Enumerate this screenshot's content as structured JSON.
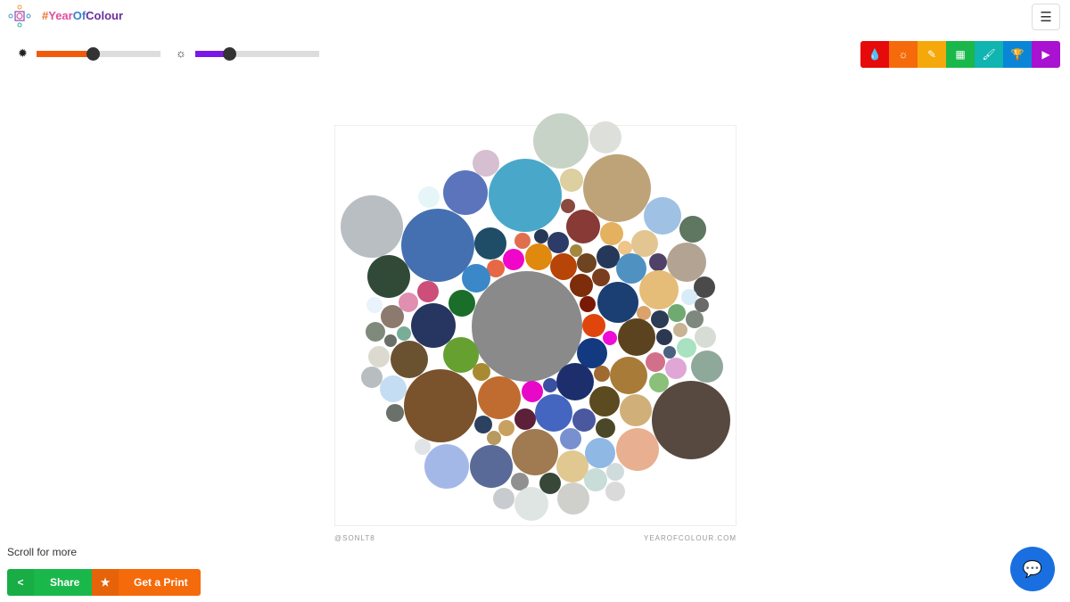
{
  "header": {
    "brand_parts": [
      "#",
      "Year",
      "Of",
      "Colour"
    ],
    "brand_colors": [
      "#e8762b",
      "#e04ea0",
      "#3a7fd0",
      "#6a2ea0"
    ],
    "menu_icon": "hamburger-icon"
  },
  "sliders": [
    {
      "icon": "dark-sun-icon",
      "glyph": "✹",
      "value": 0.45,
      "color": "#f05a0a"
    },
    {
      "icon": "light-sun-icon",
      "glyph": "☼",
      "value": 0.27,
      "color": "#7a18e8"
    }
  ],
  "toolbar": [
    {
      "icon": "drop-icon",
      "glyph": "💧",
      "color": "#e60a0a"
    },
    {
      "icon": "sun-icon",
      "glyph": "☼",
      "color": "#f56a0a"
    },
    {
      "icon": "eyedropper-icon",
      "glyph": "✎",
      "color": "#f5a80a"
    },
    {
      "icon": "calendar-icon",
      "glyph": "▦",
      "color": "#1ab84a"
    },
    {
      "icon": "brush-icon",
      "glyph": "🖌",
      "color": "#10b4b0"
    },
    {
      "icon": "trophy-icon",
      "glyph": "🏆",
      "color": "#0a86d8"
    },
    {
      "icon": "play-icon",
      "glyph": "▶",
      "color": "#a812d0"
    }
  ],
  "artwork": {
    "credit_left": "@SONLT8",
    "credit_right": "YEAROFCOLOUR.COM",
    "colors": [
      "#c8d3c8",
      "#dde0da",
      "#d5bfd0",
      "#5b74bc",
      "#49a8c9",
      "#dccfa0",
      "#bfa378",
      "#e6f6f8",
      "#b9bec2",
      "#4470b1",
      "#9ec1e4",
      "#5f7660",
      "#8a4a3e",
      "#873a36",
      "#1f4c67",
      "#e06f4e",
      "#263858",
      "#2c3b68",
      "#e3b15f",
      "#e3c592",
      "#efc58a",
      "#a1883e",
      "#e0890f",
      "#f006c8",
      "#e66845",
      "#b84508",
      "#6e4421",
      "#26385a",
      "#4f4168",
      "#b3a392",
      "#314a38",
      "#3a88c8",
      "#8a8a8a",
      "#4f92c2",
      "#7a3e1f",
      "#7d2d0a",
      "#cc4e79",
      "#e5bc78",
      "#4a4a4a",
      "#d8ebf8",
      "#e08fb0",
      "#1a6e2a",
      "#1b3f73",
      "#e8f3fb",
      "#7a1a06",
      "#6a6a6a",
      "#d9a36b",
      "#8c7a6e",
      "#273561",
      "#6faa70",
      "#2d3c55",
      "#7f887f",
      "#e0460c",
      "#7f8a7c",
      "#78ad98",
      "#6a6f6a",
      "#c8b394",
      "#f00cd8",
      "#5c4320",
      "#2c3850",
      "#d7ddd4",
      "#a8e2c0",
      "#4a6280",
      "#dcdad0",
      "#65a030",
      "#6a5230",
      "#133a80",
      "#8ea89a",
      "#d2708a",
      "#e0a6d6",
      "#a87c38",
      "#a88a30",
      "#a06a30",
      "#b8bec0",
      "#1c2f6c",
      "#c4ddf2",
      "#8ac07a",
      "#7a522c",
      "#c06c30",
      "#e808c8",
      "#3a50a0",
      "#5c4a20",
      "#574940",
      "#4466c0",
      "#6a706a",
      "#5c2038",
      "#4a58a0",
      "#d0b078",
      "#2c4060",
      "#c8a060",
      "#4a4828",
      "#b89a60",
      "#a07a50",
      "#7890d0",
      "#e8b090",
      "#e0e4e6",
      "#a4b8e8",
      "#5a6a98",
      "#90b8e4",
      "#e0c890",
      "#909090",
      "#d0dcdc",
      "#c8dcd8",
      "#384838",
      "#dadada",
      "#c8ccd0",
      "#dfe5e2",
      "#cfd0cc"
    ]
  },
  "footer": {
    "scroll_hint": "Scroll for more",
    "share_label": "Share",
    "share_icon": "share-icon",
    "share_color": "#1ab84a",
    "print_label": "Get a Print",
    "print_icon": "star-icon",
    "print_color": "#f56a0a",
    "chat_icon": "chat-icon"
  }
}
